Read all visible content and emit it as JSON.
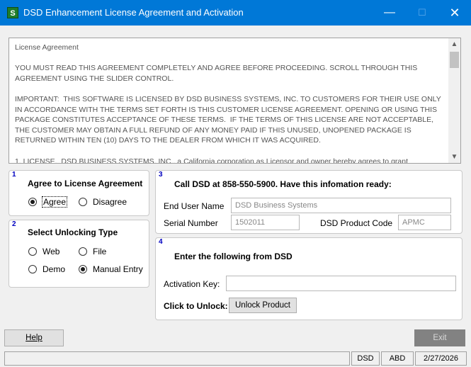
{
  "window": {
    "title": "DSD Enhancement License Agreement and Activation",
    "app_icon_text": "S",
    "minimize": "—",
    "maximize": "☐",
    "close": "✕"
  },
  "license": {
    "text": "License Agreement\n\nYOU MUST READ THIS AGREEMENT COMPLETELY AND AGREE BEFORE PROCEEDING. SCROLL THROUGH THIS AGREEMENT USING THE SLIDER CONTROL.\n\nIMPORTANT:  THIS SOFTWARE IS LICENSED BY DSD BUSINESS SYSTEMS, INC. TO CUSTOMERS FOR THEIR USE ONLY IN ACCORDANCE WITH THE TERMS SET FORTH IS THIS CUSTOMER LICENSE AGREEMENT. OPENING OR USING THIS PACKAGE CONSTITUTES ACCEPTANCE OF THESE TERMS.  IF THE TERMS OF THIS LICENSE ARE NOT ACCEPTABLE, THE CUSTOMER MAY OBTAIN A FULL REFUND OF ANY MONEY PAID IF THIS UNUSED, UNOPENED PACKAGE IS RETURNED WITHIN TEN (10) DAYS TO THE DEALER FROM WHICH IT WAS ACQUIRED.\n\n1. LICENSE.  DSD BUSINESS SYSTEMS, INC., a California corporation as Licensor and owner hereby agrees to grant",
    "scroll_up": "▲",
    "scroll_down": "▼"
  },
  "agree_group": {
    "number": "1",
    "title": "Agree to License Agreement",
    "options": [
      {
        "label": "Agree",
        "selected": true
      },
      {
        "label": "Disagree",
        "selected": false
      }
    ]
  },
  "unlock_group": {
    "number": "2",
    "title": "Select Unlocking Type",
    "options": [
      {
        "label": "Web",
        "selected": false
      },
      {
        "label": "File",
        "selected": false
      },
      {
        "label": "Demo",
        "selected": false
      },
      {
        "label": "Manual Entry",
        "selected": true
      }
    ]
  },
  "call_group": {
    "number": "3",
    "title": "Call DSD at 858-550-5900.  Have this infomation ready:",
    "end_user_label": "End User Name",
    "end_user_value": "DSD Business Systems",
    "serial_label": "Serial Number",
    "serial_value": "1502011",
    "product_code_label": "DSD Product Code",
    "product_code_value": "APMC"
  },
  "enter_group": {
    "number": "4",
    "title": "Enter the following from DSD",
    "activation_label": "Activation Key:",
    "activation_value": "",
    "unlock_label": "Click to Unlock:",
    "unlock_button": "Unlock Product"
  },
  "footer": {
    "help_button": "Help",
    "exit_button": "Exit"
  },
  "statusbar": {
    "company": "DSD",
    "user": "ABD",
    "date": "2/27/2026"
  }
}
